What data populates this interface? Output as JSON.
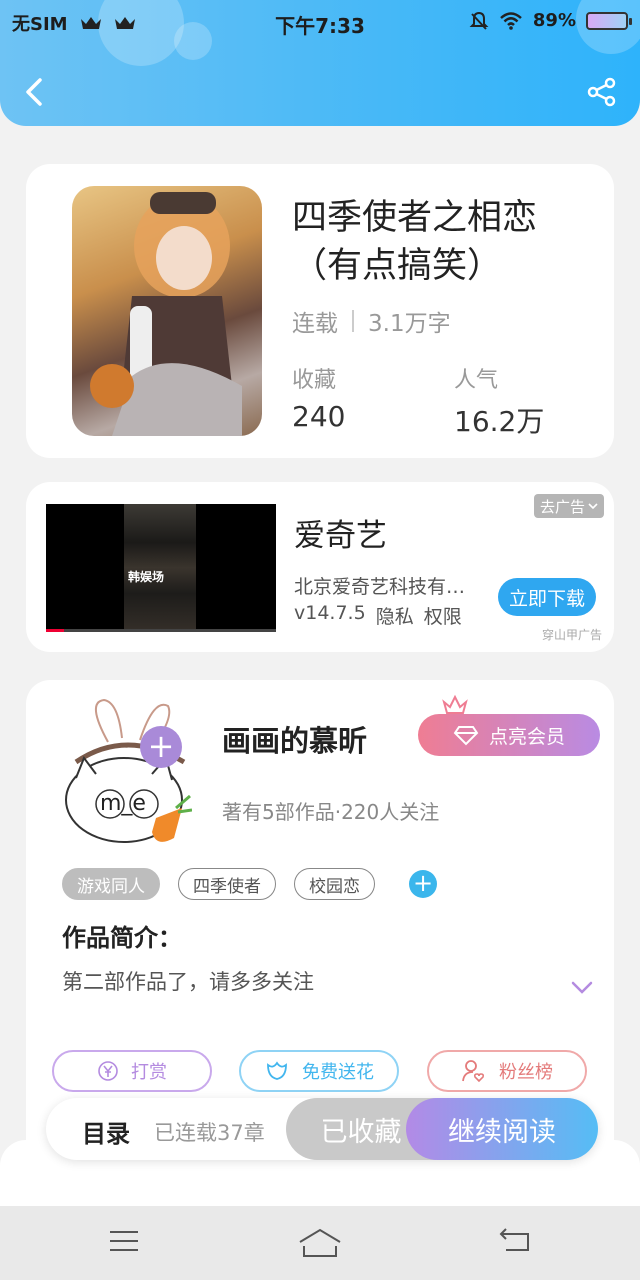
{
  "status_bar": {
    "carrier": "无SIM",
    "time": "下午7:33",
    "battery": "89%"
  },
  "book": {
    "title": "四季使者之相恋（有点搞笑）",
    "status": "连载",
    "word_count": "3.1万字",
    "favorites_label": "收藏",
    "favorites_value": "240",
    "popularity_label": "人气",
    "popularity_value": "16.2万"
  },
  "ad": {
    "video_caption": "韩娱场",
    "title": "爱奇艺",
    "company": "北京爱奇艺科技有限公司",
    "version": "v14.7.5",
    "privacy": "隐私",
    "permissions": "权限",
    "remove_label": "去广告",
    "download_label": "立即下载",
    "source_tag": "穿山甲广告"
  },
  "author": {
    "avatar_text": "m_e",
    "name": "画画的慕昕",
    "vip_label": "点亮会员",
    "stats": "著有5部作品·220人关注",
    "tags": [
      "游戏同人",
      "四季使者",
      "校园恋"
    ],
    "intro_label": "作品简介：",
    "intro_text": "第二部作品了，请多多关注"
  },
  "actions": {
    "reward": "打赏",
    "flowers": "免费送花",
    "fans": "粉丝榜"
  },
  "bottom_bar": {
    "toc": "目录",
    "chapters": "已连载37章",
    "collected": "已收藏",
    "continue": "继续阅读"
  },
  "colors": {
    "header": "#46b8f7",
    "accent_blue": "#2fa7f0",
    "accent_purple": "#b38ae6",
    "reward": "#b48be0",
    "flowers": "#42b6ee",
    "fans": "#e47b7b"
  }
}
